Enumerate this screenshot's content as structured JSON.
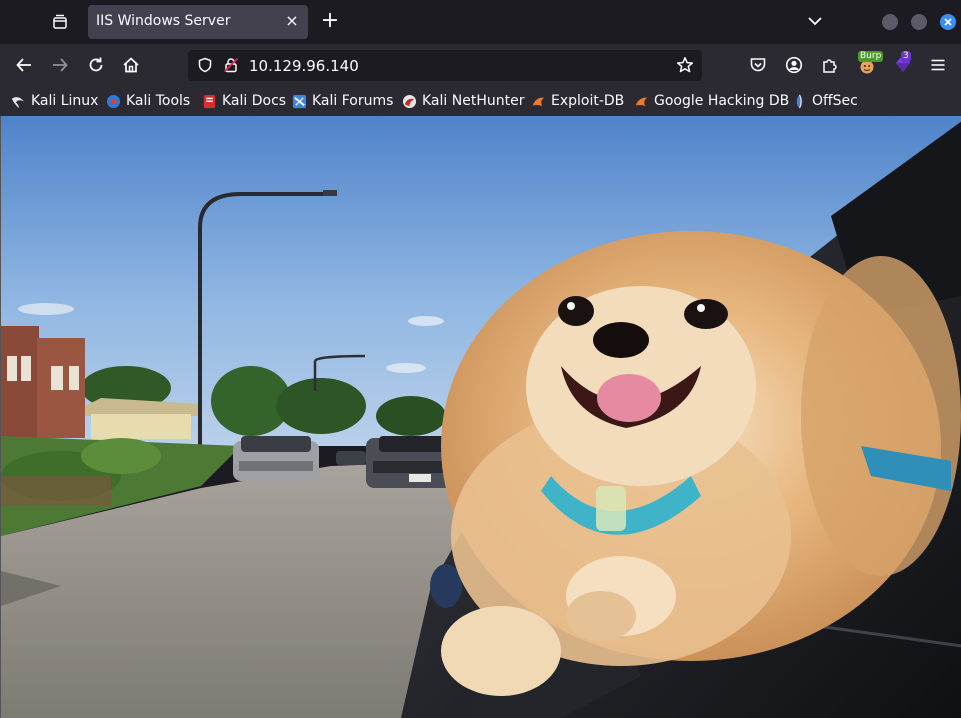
{
  "tab": {
    "title": "IIS Windows Server",
    "close_symbol": "×"
  },
  "new_tab_symbol": "+",
  "nav": {
    "url": "10.129.96.140"
  },
  "extensions": {
    "burp_badge": "Burp",
    "notification_count": "3"
  },
  "bookmarks": [
    {
      "label": "Kali Linux",
      "icon": "kali-dragon-icon",
      "color": "#e6e6e6"
    },
    {
      "label": "Kali Tools",
      "icon": "kali-tools-icon",
      "color": "#2d7bd6"
    },
    {
      "label": "Kali Docs",
      "icon": "kali-docs-icon",
      "color": "#d32f2f"
    },
    {
      "label": "Kali Forums",
      "icon": "kali-forums-icon",
      "color": "#3a86e0"
    },
    {
      "label": "Kali NetHunter",
      "icon": "nethunter-icon",
      "color": "#c62828"
    },
    {
      "label": "Exploit-DB",
      "icon": "exploit-db-icon",
      "color": "#f07a28"
    },
    {
      "label": "Google Hacking DB",
      "icon": "ghdb-icon",
      "color": "#f07a28"
    },
    {
      "label": "OffSec",
      "icon": "offsec-icon",
      "color": "#4a7fd6"
    }
  ],
  "colors": {
    "accent": "#3a8ef6",
    "toolbar": "#2b2a33",
    "tabstrip": "#1c1b22"
  }
}
